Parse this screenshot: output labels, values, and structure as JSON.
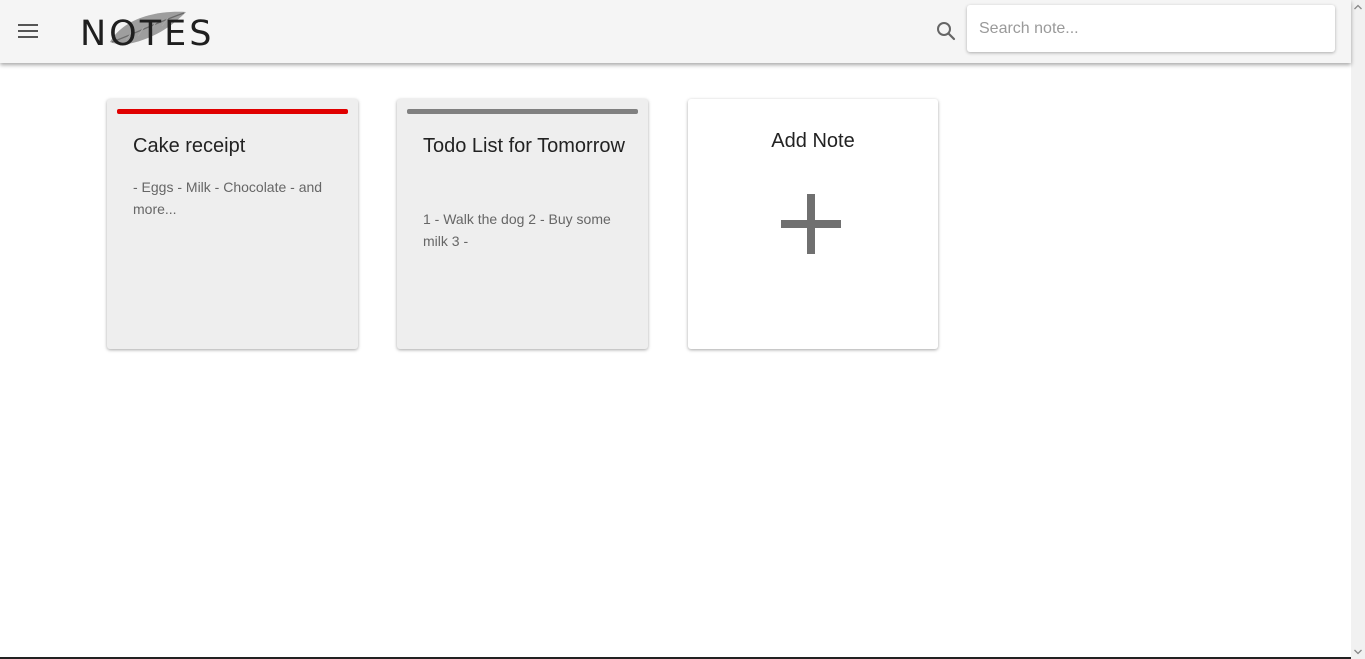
{
  "header": {
    "logo_text": "NOTES",
    "menu_icon": "menu-icon",
    "search_icon": "search-icon",
    "search_placeholder": "Search note...",
    "search_value": ""
  },
  "notes": [
    {
      "title": "Cake receipt",
      "body": "- Eggs - Milk - Chocolate - and more...",
      "color": "#e00000"
    },
    {
      "title": "Todo List for Tomorrow",
      "body": "1 - Walk the dog 2 - Buy some milk 3 -",
      "color": "#808080"
    }
  ],
  "add_note": {
    "label": "Add Note",
    "icon": "plus-icon"
  },
  "colors": {
    "appbar_bg": "#f5f5f5",
    "card_bg": "#eeeeee",
    "accent_red": "#e00000"
  }
}
